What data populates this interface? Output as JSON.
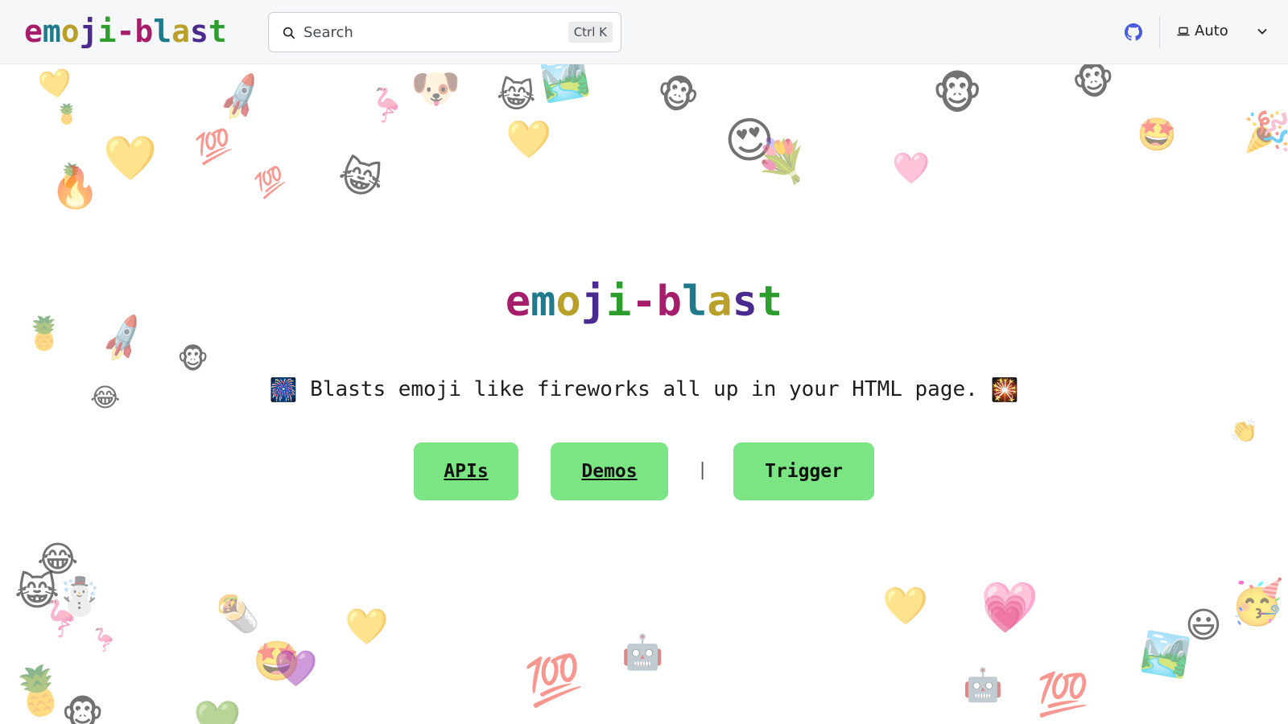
{
  "navbar": {
    "logo_letters": [
      {
        "ch": "e",
        "color": "#a51d6b"
      },
      {
        "ch": "m",
        "color": "#1f7a8c"
      },
      {
        "ch": "o",
        "color": "#b8a02a"
      },
      {
        "ch": "j",
        "color": "#4b2a8f"
      },
      {
        "ch": "i",
        "color": "#2d9d2d"
      },
      {
        "ch": "-",
        "color": "#a51d6b"
      },
      {
        "ch": "b",
        "color": "#a51d6b"
      },
      {
        "ch": "l",
        "color": "#1f7a8c"
      },
      {
        "ch": "a",
        "color": "#b8a02a"
      },
      {
        "ch": "s",
        "color": "#4b2a8f"
      },
      {
        "ch": "t",
        "color": "#2d9d2d"
      }
    ],
    "search": {
      "placeholder": "Search",
      "shortcut": "Ctrl K"
    },
    "github_icon": "github-icon",
    "theme": {
      "label": "Auto",
      "icon": "laptop-icon"
    }
  },
  "hero": {
    "title": "emoji-blast",
    "tagline": "Blasts emoji like fireworks all up in your HTML page.",
    "tagline_left_emoji": "🎆",
    "tagline_right_emoji": "🎇",
    "buttons": {
      "apis": "APIs",
      "demos": "Demos",
      "separator": "|",
      "trigger": "Trigger"
    }
  },
  "decor_emoji": [
    "💛",
    "🍍",
    "🚀",
    "🦩",
    "🐶",
    "😹",
    "🏞️",
    "🐵",
    "🐵",
    "🤩",
    "🐵",
    "🍍",
    "💯",
    "💯",
    "😹",
    "🔥",
    "💛",
    "💛",
    "😍",
    "💐",
    "🩷",
    "🍍",
    "🚀",
    "🐵",
    "😂",
    "👏",
    "😂",
    "😹",
    "☃️",
    "🦩",
    "🦩",
    "🌯",
    "🤩",
    "💜",
    "💯",
    "💛",
    "🏞️",
    "🩷",
    "🤖",
    "💛",
    "💗",
    "😃",
    "🐵",
    "💚",
    "🍍",
    "💯",
    "🥳",
    "🤖",
    "🎉"
  ],
  "colors": {
    "button_bg": "#7ae582",
    "navbar_bg": "#f6f7f8",
    "github_blue": "#4a5be0"
  }
}
